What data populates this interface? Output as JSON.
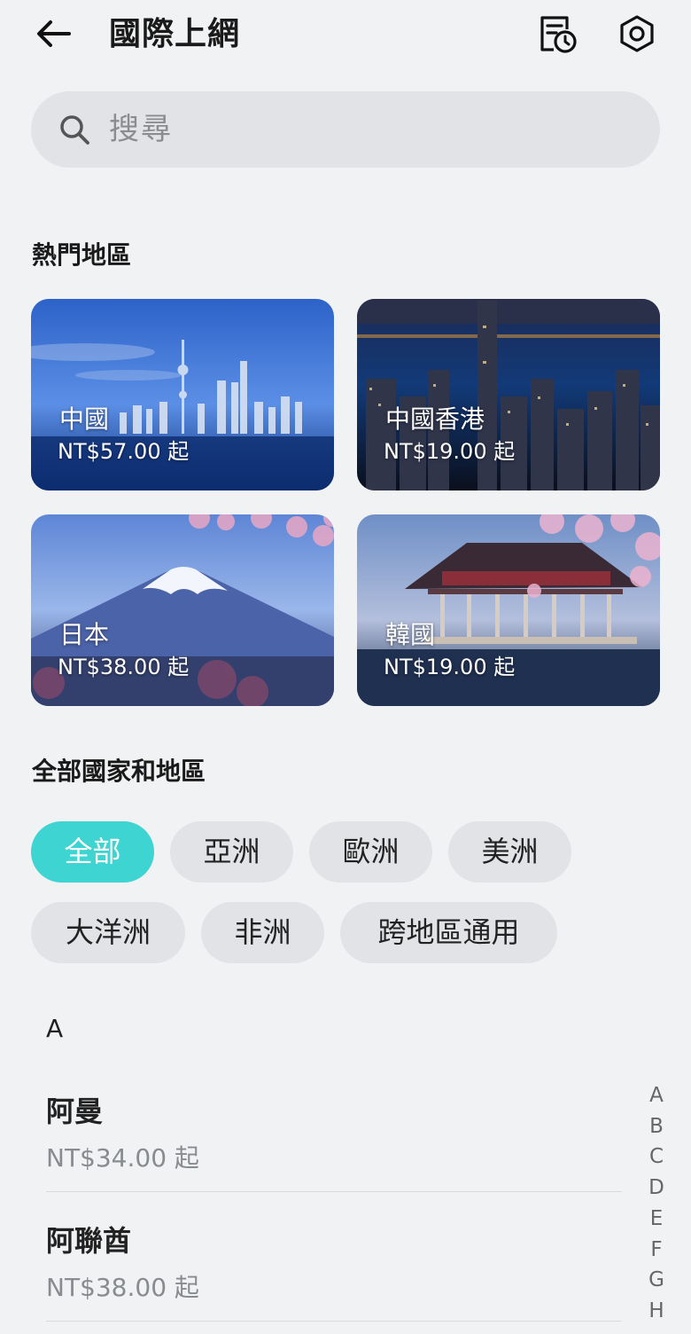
{
  "header": {
    "title": "國際上網",
    "back_icon": "arrow-left-icon",
    "orders_icon": "order-history-icon",
    "settings_icon": "hexagon-settings-icon"
  },
  "search": {
    "placeholder": "搜尋"
  },
  "popular": {
    "title": "熱門地區",
    "cards": [
      {
        "name": "中國",
        "price": "NT$57.00 起"
      },
      {
        "name": "中國香港",
        "price": "NT$19.00 起"
      },
      {
        "name": "日本",
        "price": "NT$38.00 起"
      },
      {
        "name": "韓國",
        "price": "NT$19.00 起"
      }
    ]
  },
  "all": {
    "title": "全部國家和地區",
    "filters": [
      "全部",
      "亞洲",
      "歐洲",
      "美洲",
      "大洋洲",
      "非洲",
      "跨地區通用"
    ],
    "active_filter": "全部",
    "accent": "#3dd4d1"
  },
  "list": {
    "section_letter": "A",
    "items": [
      {
        "name": "阿曼",
        "price": "NT$34.00 起"
      },
      {
        "name": "阿聯酋",
        "price": "NT$38.00 起"
      }
    ]
  },
  "alpha_index": [
    "A",
    "B",
    "C",
    "D",
    "E",
    "F",
    "G",
    "H"
  ]
}
